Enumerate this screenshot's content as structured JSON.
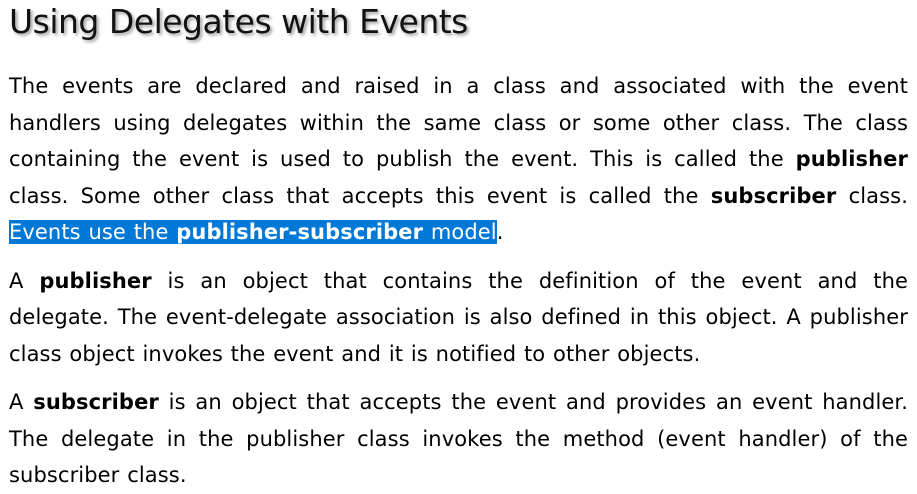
{
  "title": "Using Delegates with Events",
  "paragraphs": [
    {
      "t1": "The events are declared and raised in a class and associated with the event handlers using delegates within the same class or some other class. The class containing the event is used to publish the event. This is called the ",
      "b1": "publisher",
      "t2": " class. Some other class that accepts this event is called the ",
      "b2": "subscriber",
      "t3": " class. ",
      "sel_t1": "Events use the ",
      "sel_b1": "publisher-subscriber",
      "sel_t2": " model",
      "t4": "."
    },
    {
      "t1": "A ",
      "b1": "publisher",
      "t2": " is an object that contains the definition of the event and the delegate. The event-delegate association is also defined in this object. A publisher class object invokes the event and it is notified to other objects."
    },
    {
      "t1": "A ",
      "b1": "subscriber",
      "t2": " is an object that accepts the event and provides an event handler. The delegate in the publisher class invokes the method (event handler) of the subscriber class."
    }
  ]
}
